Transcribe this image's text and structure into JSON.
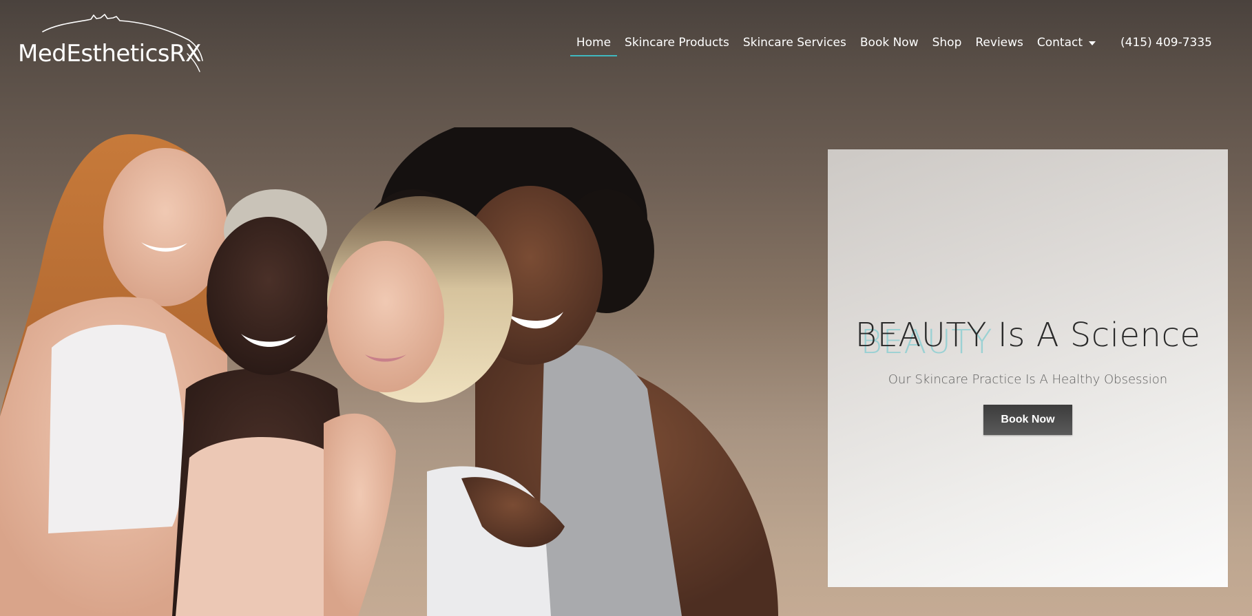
{
  "brand": {
    "name": "MedEstheticsRX"
  },
  "nav": {
    "items": [
      {
        "label": "Home",
        "active": true
      },
      {
        "label": "Skincare Products"
      },
      {
        "label": "Skincare Services"
      },
      {
        "label": "Book Now"
      },
      {
        "label": "Shop"
      },
      {
        "label": "Reviews"
      },
      {
        "label": "Contact",
        "has_dropdown": true
      }
    ],
    "phone": "(415) 409-7335",
    "active_underline_color": "#3fb9c0"
  },
  "hero": {
    "heading_accent": "BEAUTY",
    "heading_rest": " Is A Science",
    "subheading": "Our Skincare Practice Is A Healthy Obsession",
    "cta_label": "Book Now",
    "accent_color": "#8fcfd2",
    "photo_alt": "four smiling women embracing"
  }
}
